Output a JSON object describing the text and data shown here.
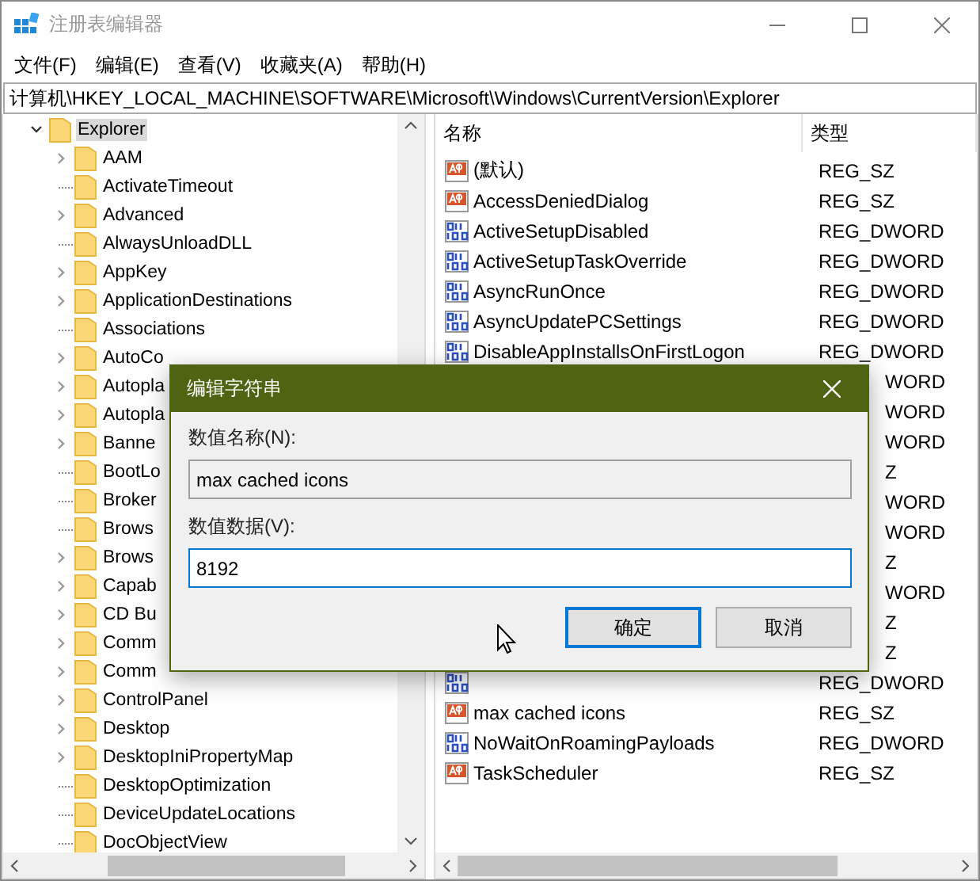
{
  "window": {
    "title": "注册表编辑器"
  },
  "menu": [
    "文件(F)",
    "编辑(E)",
    "查看(V)",
    "收藏夹(A)",
    "帮助(H)"
  ],
  "address": "计算机\\HKEY_LOCAL_MACHINE\\SOFTWARE\\Microsoft\\Windows\\CurrentVersion\\Explorer",
  "tree": [
    {
      "label": "Explorer",
      "selected": true,
      "expanded": true,
      "children": [
        {
          "label": "AAM",
          "has_children": true
        },
        {
          "label": "ActivateTimeout",
          "has_children": false
        },
        {
          "label": "Advanced",
          "has_children": true
        },
        {
          "label": "AlwaysUnloadDLL",
          "has_children": false
        },
        {
          "label": "AppKey",
          "has_children": true
        },
        {
          "label": "ApplicationDestinations",
          "has_children": true
        },
        {
          "label": "Associations",
          "has_children": false
        },
        {
          "label": "AutoCo",
          "has_children": true
        },
        {
          "label": "Autopla",
          "has_children": true
        },
        {
          "label": "Autopla",
          "has_children": true
        },
        {
          "label": "Banne",
          "has_children": true
        },
        {
          "label": "BootLo",
          "has_children": false
        },
        {
          "label": "Broker",
          "has_children": false
        },
        {
          "label": "Brows",
          "has_children": false
        },
        {
          "label": "Brows",
          "has_children": true
        },
        {
          "label": "Capab",
          "has_children": true
        },
        {
          "label": "CD Bu",
          "has_children": true
        },
        {
          "label": "Comm",
          "has_children": true
        },
        {
          "label": "Comm",
          "has_children": true
        },
        {
          "label": "ControlPanel",
          "has_children": true
        },
        {
          "label": "Desktop",
          "has_children": true
        },
        {
          "label": "DesktopIniPropertyMap",
          "has_children": true
        },
        {
          "label": "DesktopOptimization",
          "has_children": false
        },
        {
          "label": "DeviceUpdateLocations",
          "has_children": false
        },
        {
          "label": "DocObjectView",
          "has_children": false
        }
      ]
    }
  ],
  "list": {
    "columns": [
      "名称",
      "类型"
    ],
    "rows": [
      {
        "kind": "sz",
        "name": "(默认)",
        "type": "REG_SZ"
      },
      {
        "kind": "sz",
        "name": "AccessDeniedDialog",
        "type": "REG_SZ"
      },
      {
        "kind": "dword",
        "name": "ActiveSetupDisabled",
        "type": "REG_DWORD"
      },
      {
        "kind": "dword",
        "name": "ActiveSetupTaskOverride",
        "type": "REG_DWORD"
      },
      {
        "kind": "dword",
        "name": "AsyncRunOnce",
        "type": "REG_DWORD"
      },
      {
        "kind": "dword",
        "name": "AsyncUpdatePCSettings",
        "type": "REG_DWORD"
      },
      {
        "kind": "dword",
        "name": "DisableAppInstallsOnFirstLogon",
        "type": "REG_DWORD"
      },
      {
        "kind": "covered",
        "type": "WORD"
      },
      {
        "kind": "covered",
        "type": "WORD"
      },
      {
        "kind": "covered",
        "type": "WORD"
      },
      {
        "kind": "covered",
        "type": "Z"
      },
      {
        "kind": "covered",
        "type": "WORD"
      },
      {
        "kind": "covered",
        "type": "WORD"
      },
      {
        "kind": "covered",
        "type": "Z"
      },
      {
        "kind": "covered",
        "type": "WORD"
      },
      {
        "kind": "covered",
        "type": "Z"
      },
      {
        "kind": "covered",
        "type": "Z"
      },
      {
        "kind": "dword",
        "type": "REG_DWORD"
      },
      {
        "kind": "sz",
        "name": "max cached icons",
        "type": "REG_SZ"
      },
      {
        "kind": "dword",
        "name": "NoWaitOnRoamingPayloads",
        "type": "REG_DWORD"
      },
      {
        "kind": "sz",
        "name": "TaskScheduler",
        "type": "REG_SZ"
      }
    ]
  },
  "dialog": {
    "title": "编辑字符串",
    "fields": [
      {
        "label": "数值名称(N):",
        "value": "max cached icons",
        "focused": false
      },
      {
        "label": "数值数据(V):",
        "value": "8192",
        "focused": true
      }
    ],
    "buttons": [
      {
        "label": "确定",
        "default": true
      },
      {
        "label": "取消",
        "default": false
      }
    ]
  }
}
